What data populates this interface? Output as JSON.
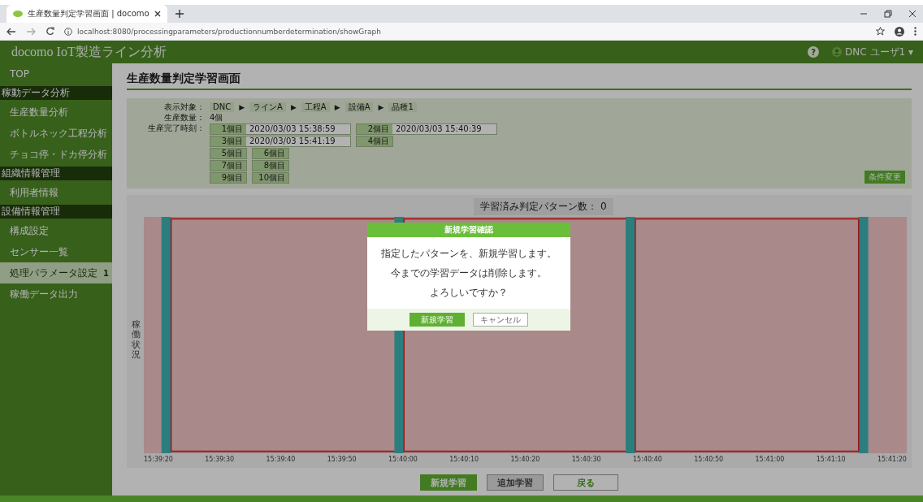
{
  "browser": {
    "tab_title": "生産数量判定学習画面 | docomo",
    "url": "localhost:8080/processingparameters/productionnumberdetermination/showGraph"
  },
  "header": {
    "title": "docomo IoT製造ライン分析",
    "help": "?",
    "user": "DNC ユーザ1 ▾"
  },
  "sidebar": {
    "items": [
      {
        "kind": "item",
        "label": "TOP",
        "selected": false
      },
      {
        "kind": "section",
        "label": "稼動データ分析"
      },
      {
        "kind": "item",
        "label": "生産数量分析",
        "selected": false
      },
      {
        "kind": "item",
        "label": "ボトルネック工程分析",
        "selected": false
      },
      {
        "kind": "item",
        "label": "チョコ停・ドカ停分析",
        "selected": false
      },
      {
        "kind": "section",
        "label": "組織情報管理"
      },
      {
        "kind": "item",
        "label": "利用者情報",
        "selected": false
      },
      {
        "kind": "section",
        "label": "設備情報管理"
      },
      {
        "kind": "item",
        "label": "構成設定",
        "selected": false
      },
      {
        "kind": "item",
        "label": "センサー一覧",
        "selected": false
      },
      {
        "kind": "item",
        "label": "処理パラメータ設定",
        "selected": true,
        "badge": "1"
      },
      {
        "kind": "item",
        "label": "稼働データ出力",
        "selected": false
      }
    ]
  },
  "page_title": "生産数量判定学習画面",
  "info": {
    "target_label": "表示対象：",
    "path": [
      "DNC",
      "ラインA",
      "工程A",
      "設備A",
      "品種1"
    ],
    "separator": "▶",
    "count_label": "生産数量：",
    "count": "4個",
    "times_label": "生産完了時刻：",
    "times": [
      [
        {
          "label": "1個目",
          "time": "2020/03/03 15:38:59"
        },
        {
          "label": "2個目",
          "time": "2020/03/03 15:40:39"
        }
      ],
      [
        {
          "label": "3個目",
          "time": "2020/03/03 15:41:19"
        },
        {
          "label": "4個目"
        }
      ],
      [
        {
          "label": "5個目"
        },
        {
          "label": "6個目"
        }
      ],
      [
        {
          "label": "7個目"
        },
        {
          "label": "8個目"
        }
      ],
      [
        {
          "label": "9個目"
        },
        {
          "label": "10個目"
        }
      ]
    ],
    "change_button": "条件変更"
  },
  "chart": {
    "pattern_count": "学習済み判定パターン数： 0",
    "y_label": "稼働状況",
    "x_ticks": [
      "15:39:20",
      "15:39:30",
      "15:39:40",
      "15:39:50",
      "15:40:00",
      "15:40:10",
      "15:40:20",
      "15:40:30",
      "15:40:40",
      "15:40:50",
      "15:41:00",
      "15:41:10",
      "15:41:20"
    ]
  },
  "actions": [
    {
      "kind": "primary",
      "label": "新規学習"
    },
    {
      "kind": "secondary",
      "label": "追加学習"
    },
    {
      "kind": "outline",
      "label": "戻る"
    }
  ],
  "dialog": {
    "title": "新規学習確認",
    "lines": [
      "指定したパターンを、新規学習します。",
      "今までの学習データは削除します。",
      "よろしいですか？"
    ],
    "ok": "新規学習",
    "cancel": "キャンセル"
  }
}
